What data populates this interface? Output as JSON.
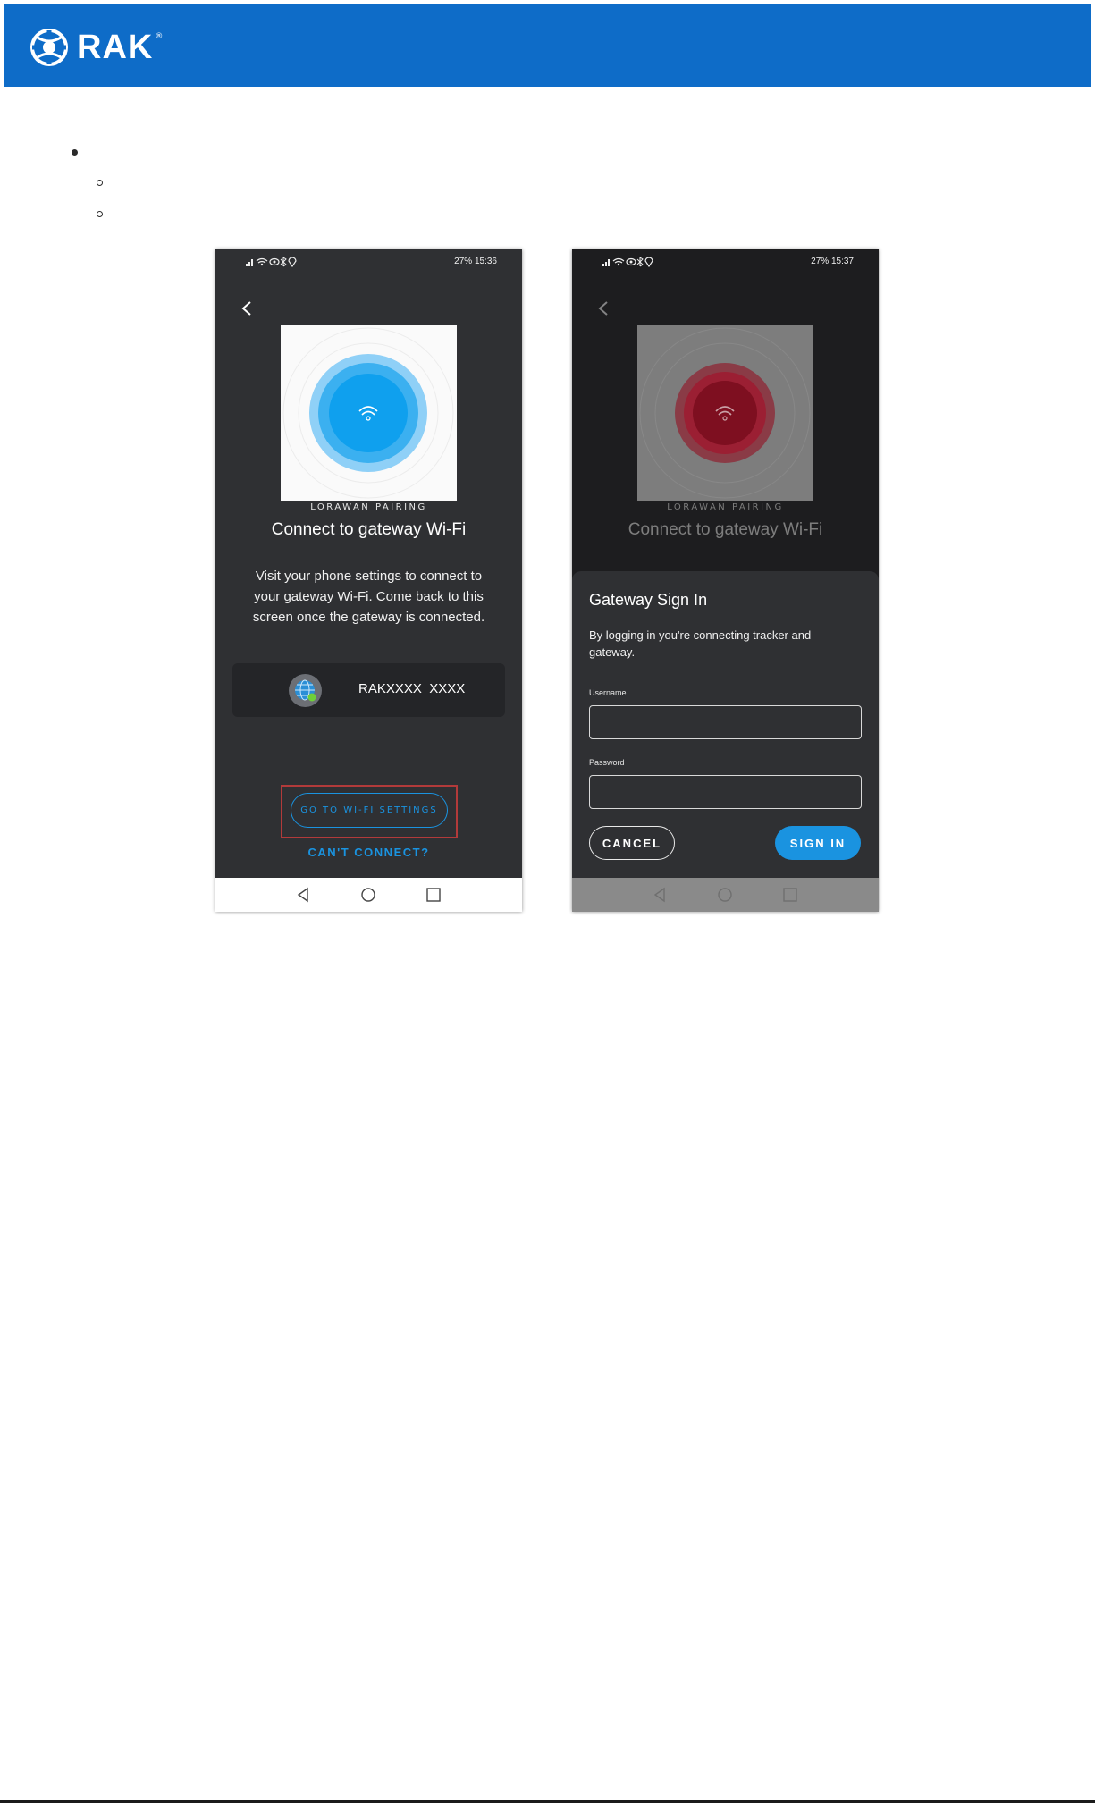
{
  "header": {
    "brand": "RAK",
    "registered": "®",
    "brand_color": "#0e6cc8"
  },
  "screens": [
    {
      "status_left": "",
      "status_right": "27%  15:36",
      "back_icon": "chevron-left-icon",
      "section_label": "LORAWAN PAIRING",
      "title": "Connect to gateway Wi-Fi",
      "description": "Visit your phone settings to connect to your gateway Wi-Fi. Come back to this screen once the gateway is connected.",
      "network_name": "RAKXXXX_XXXX",
      "wifi_settings_button": "GO TO WI-FI SETTINGS",
      "cant_connect": "CAN'T CONNECT?",
      "accent_color": "#1a93e0"
    },
    {
      "status_right": "27%  15:37",
      "section_label": "LORAWAN PAIRING",
      "title": "Connect to gateway Wi-Fi",
      "dialog": {
        "title": "Gateway Sign In",
        "description": "By logging in you're connecting tracker and gateway.",
        "username_label": "Username",
        "username_value": "",
        "password_label": "Password",
        "password_value": "",
        "cancel_button": "CANCEL",
        "sign_in_button": "SIGN IN"
      },
      "status_color": "#b0182b"
    }
  ]
}
